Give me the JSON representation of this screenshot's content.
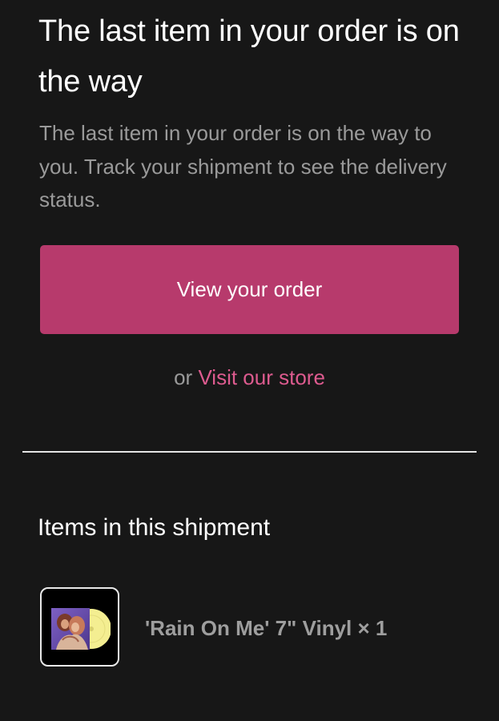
{
  "headline": "The last item in your order is on the way",
  "body": "The last item in your order is on the way to you. Track your shipment to see the delivery status.",
  "cta": {
    "label": "View your order"
  },
  "alt": {
    "prefix": "or",
    "link": "Visit our store"
  },
  "section": {
    "title": "Items in this shipment"
  },
  "items": [
    {
      "name": "'Rain On Me' 7\" Vinyl × 1",
      "thumbnail_icon": "vinyl-record-cover"
    }
  ],
  "colors": {
    "background": "#171717",
    "button": "#b73a6c",
    "link": "#dd5b8f",
    "muted_text": "#9a9a9a",
    "vinyl": "#f4ee91",
    "cover": "#6a4fb1"
  }
}
